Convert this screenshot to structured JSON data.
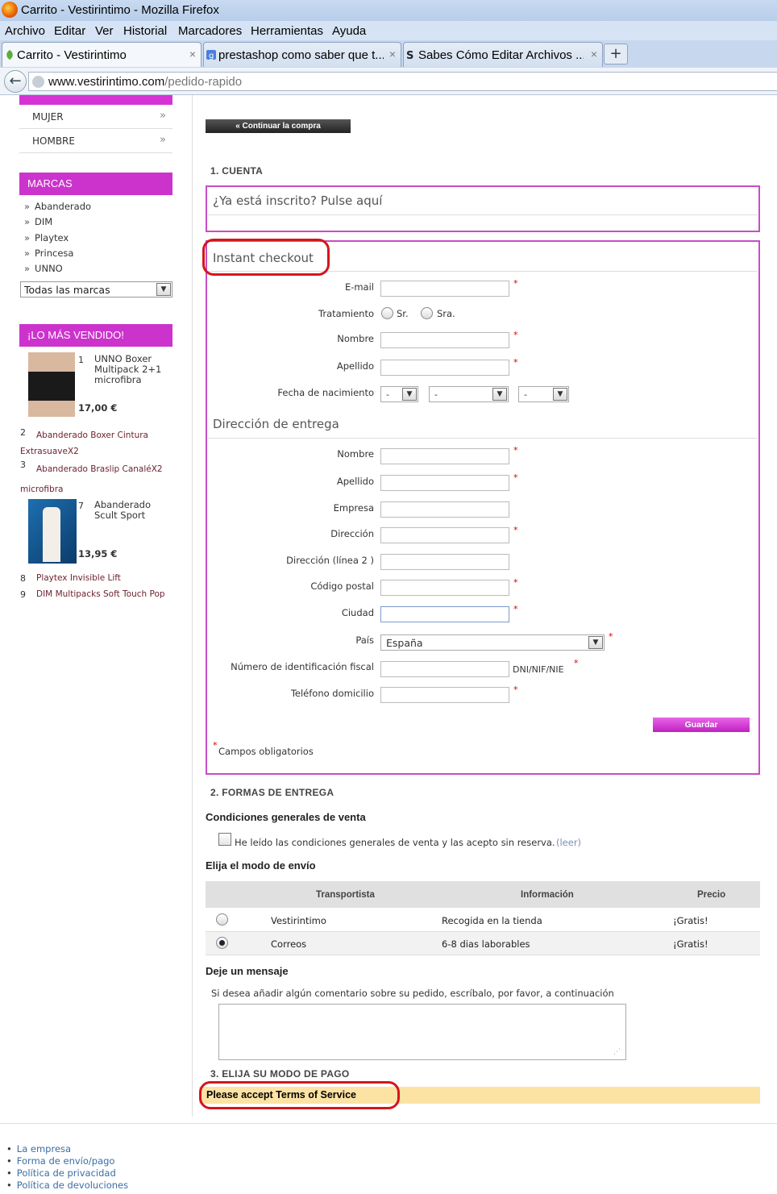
{
  "browser": {
    "window_title": "Carrito - Vestirintimo - Mozilla Firefox",
    "menu": [
      "Archivo",
      "Editar",
      "Ver",
      "Historial",
      "Marcadores",
      "Herramientas",
      "Ayuda"
    ],
    "tabs": [
      {
        "label": "Carrito - Vestirintimo",
        "close": "×"
      },
      {
        "label": "prestashop como saber que t...",
        "close": "×"
      },
      {
        "label": "Sabes Cómo Editar Archivos ....",
        "close": "×"
      }
    ],
    "new_tab": "+",
    "url_domain": "www.vestirintimo.com",
    "url_path": "/pedido-rapido"
  },
  "sidebar": {
    "categories": [
      {
        "label": "MUJER",
        "arrow": "»"
      },
      {
        "label": "HOMBRE",
        "arrow": "»"
      }
    ],
    "brands_title": "MARCAS",
    "brands": [
      "Abanderado",
      "DIM",
      "Playtex",
      "Princesa",
      "UNNO"
    ],
    "brand_select": "Todas las marcas",
    "bestsellers_title": "¡LO MÁS VENDIDO!",
    "bestsellers": [
      {
        "num": "1",
        "name": "UNNO Boxer Multipack 2+1 microfibra",
        "price": "17,00 €"
      },
      {
        "num": "2",
        "name": "Abanderado Boxer Cintura ExtrasuaveX2"
      },
      {
        "num": "3",
        "name": "Abanderado Braslip CanaléX2 microfibra"
      },
      {
        "num": "7",
        "name": "Abanderado Scult Sport",
        "price": "13,95 €"
      },
      {
        "num": "8",
        "name": "Playtex Invisible Lift"
      },
      {
        "num": "9",
        "name": "DIM Multipacks Soft Touch Pop"
      }
    ]
  },
  "main": {
    "continue_button": "« Continuar la compra",
    "section1_title": "1. CUENTA",
    "login_prompt": "¿Ya está inscrito? Pulse aquí",
    "instant_checkout": "Instant checkout",
    "fields": {
      "email": "E-mail",
      "title": "Tratamiento",
      "mr": "Sr.",
      "mrs": "Sra.",
      "first_name": "Nombre",
      "last_name": "Apellido",
      "birthdate": "Fecha de nacimiento",
      "birth_default": "-"
    },
    "delivery_title": "Dirección de entrega",
    "address_fields": {
      "first_name": "Nombre",
      "last_name": "Apellido",
      "company": "Empresa",
      "address1": "Dirección",
      "address2": "Dirección (línea 2 )",
      "postcode": "Código postal",
      "city": "Ciudad",
      "country": "País",
      "country_value": "España",
      "dni": "Número de identificación fiscal",
      "dni_hint": "DNI/NIF/NIE",
      "phone": "Teléfono domicilio"
    },
    "save_button": "Guardar",
    "required_note": "Campos obligatorios",
    "required_mark": "*",
    "section2_title": "2. FORMAS DE ENTREGA",
    "terms_title": "Condiciones generales de venta",
    "terms_text": "He leído las condiciones generales de venta y las acepto sin reserva.",
    "terms_link": "(leer)",
    "shipping_title": "Elija el modo de envío",
    "carrier_headers": [
      "Transportista",
      "Información",
      "Precio"
    ],
    "carriers": [
      {
        "name": "Vestirintimo",
        "info": "Recogida en la tienda",
        "price": "¡Gratis!",
        "selected": false
      },
      {
        "name": "Correos",
        "info": "6-8 dias laborables",
        "price": "¡Gratis!",
        "selected": true
      }
    ],
    "message_title": "Deje un mensaje",
    "message_hint": "Si desea añadir algún comentario sobre su pedido, escríbalo, por favor, a continuación",
    "section3_title": "3. ELIJA SU MODO DE PAGO",
    "warning": "Please accept Terms of Service"
  },
  "footer": {
    "links": [
      "La empresa",
      "Forma de envío/pago",
      "Política de privacidad",
      "Política de devoluciones"
    ]
  },
  "colors": {
    "accent": "#cc33cc",
    "annotation": "#d4161c",
    "warning_bg": "#fce3a4"
  }
}
